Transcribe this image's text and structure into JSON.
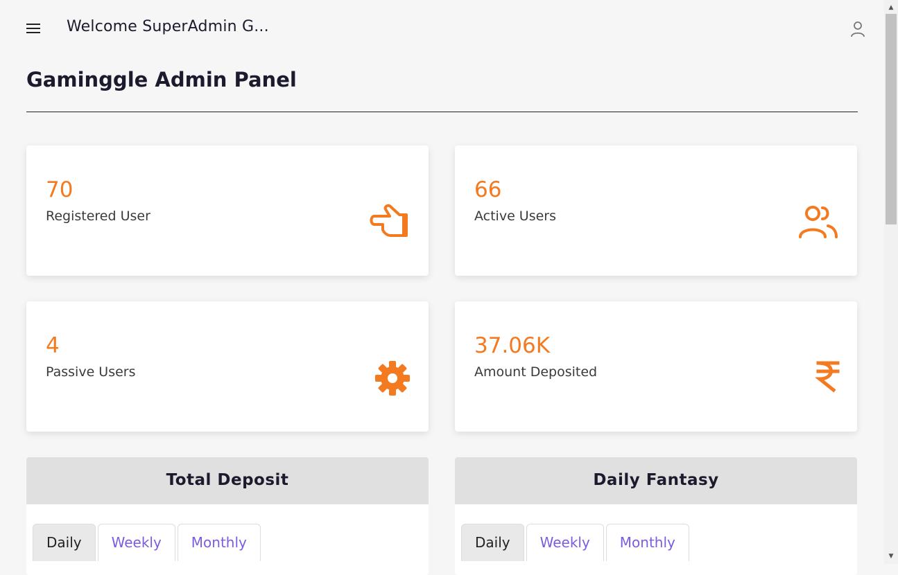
{
  "header": {
    "welcome": "Welcome SuperAdmin G...",
    "menu_icon": "hamburger-menu-icon",
    "user_icon": "user-icon"
  },
  "page": {
    "title": "Gaminggle Admin Panel"
  },
  "stats": [
    {
      "value": "70",
      "label": "Registered User",
      "icon": "pointing-hand-icon"
    },
    {
      "value": "66",
      "label": "Active Users",
      "icon": "users-icon"
    },
    {
      "value": "4",
      "label": "Passive Users",
      "icon": "gear-icon"
    },
    {
      "value": "37.06K",
      "label": "Amount Deposited",
      "icon": "rupee-icon"
    }
  ],
  "panels": [
    {
      "title": "Total Deposit",
      "tabs": [
        "Daily",
        "Weekly",
        "Monthly"
      ],
      "active_tab": "Daily"
    },
    {
      "title": "Daily Fantasy",
      "tabs": [
        "Daily",
        "Weekly",
        "Monthly"
      ],
      "active_tab": "Daily"
    }
  ],
  "colors": {
    "accent": "#f47a20",
    "tab_text": "#7b5ce0",
    "title": "#1c1b2e"
  }
}
